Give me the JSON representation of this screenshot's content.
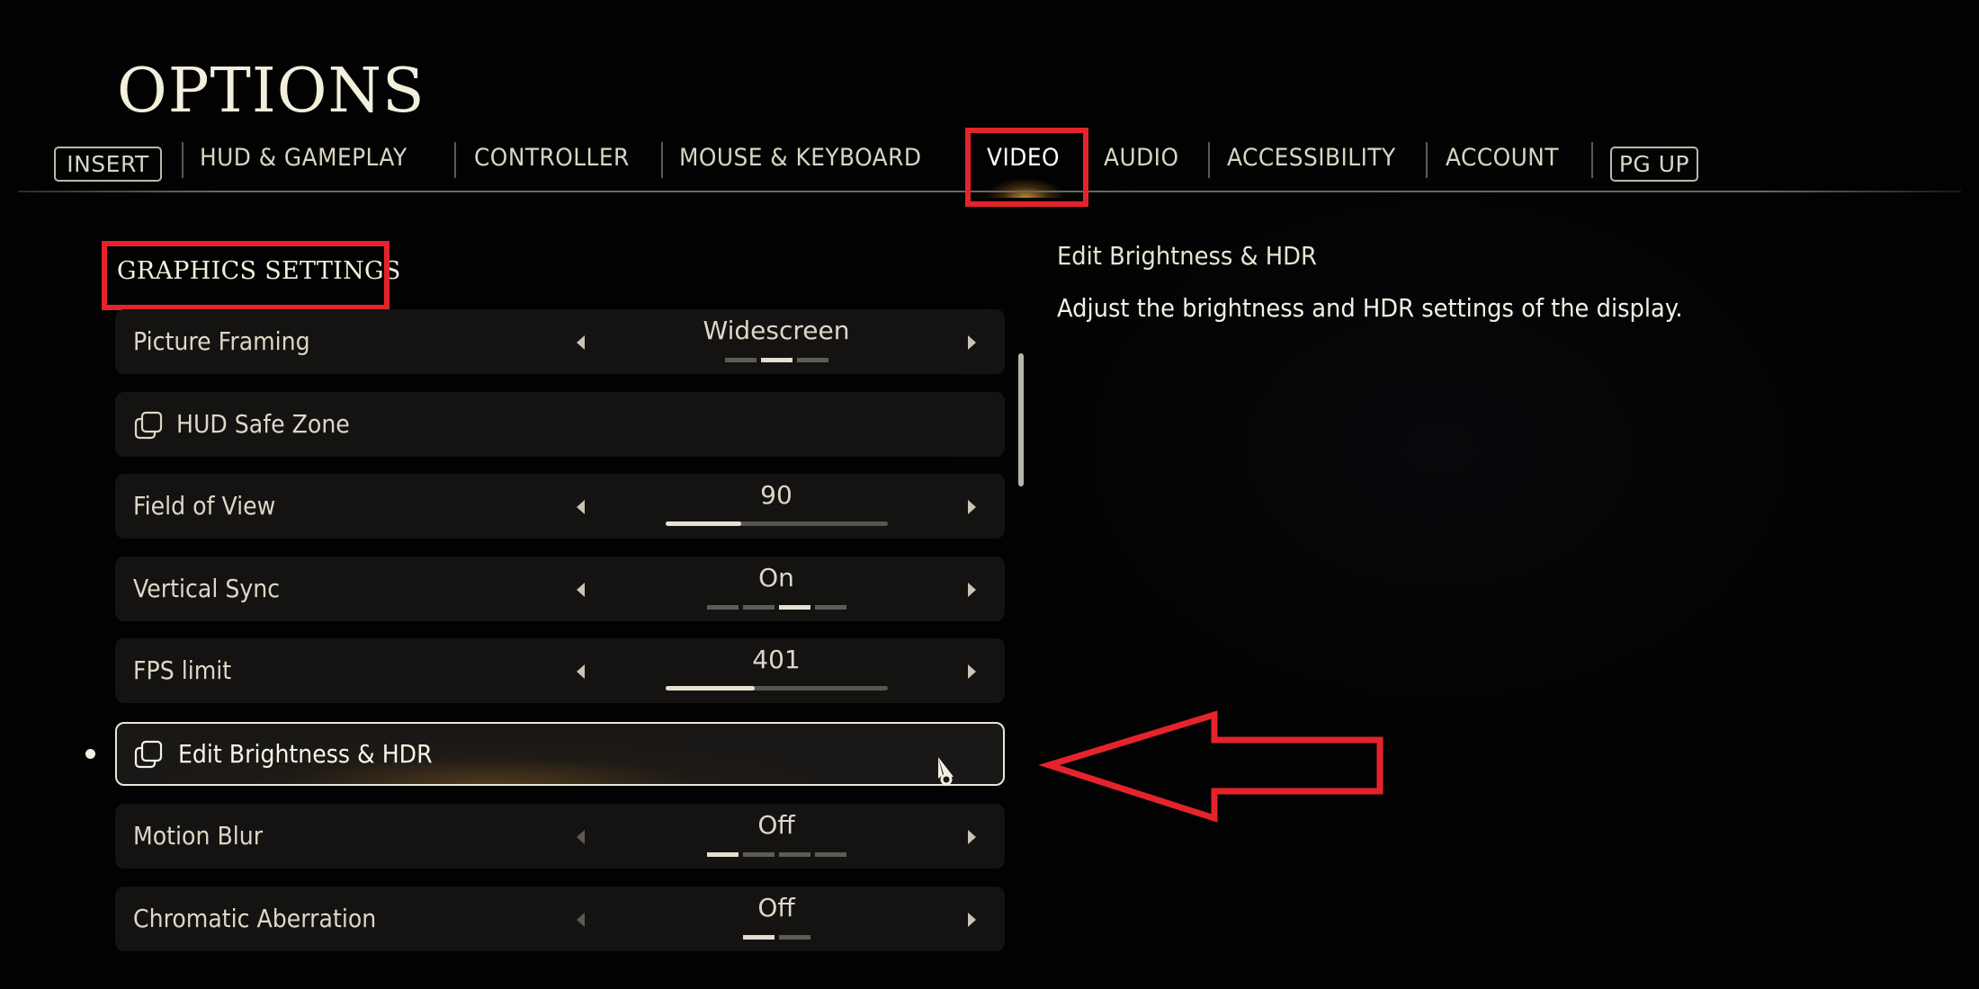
{
  "title": "OPTIONS",
  "tabs": {
    "prev_key": "INSERT",
    "next_key": "PG UP",
    "items": [
      {
        "label": "HUD & GAMEPLAY",
        "active": false
      },
      {
        "label": "CONTROLLER",
        "active": false
      },
      {
        "label": "MOUSE & KEYBOARD",
        "active": false
      },
      {
        "label": "VIDEO",
        "active": true
      },
      {
        "label": "AUDIO",
        "active": false
      },
      {
        "label": "ACCESSIBILITY",
        "active": false
      },
      {
        "label": "ACCOUNT",
        "active": false
      }
    ]
  },
  "section": {
    "title": "GRAPHICS SETTINGS"
  },
  "settings": [
    {
      "label": "Picture Framing",
      "type": "choice",
      "value": "Widescreen",
      "option_count": 3,
      "selected_index": 1,
      "left_disabled": false
    },
    {
      "label": "HUD Safe Zone",
      "type": "submenu",
      "icon": "external-window-icon"
    },
    {
      "label": "Field of View",
      "type": "slider",
      "value": "90",
      "fill_fraction": 0.34
    },
    {
      "label": "Vertical Sync",
      "type": "choice",
      "value": "On",
      "option_count": 4,
      "selected_index": 2,
      "left_disabled": false
    },
    {
      "label": "FPS limit",
      "type": "slider",
      "value": "401",
      "fill_fraction": 0.4
    },
    {
      "label": "Edit Brightness & HDR",
      "type": "submenu",
      "icon": "external-window-icon",
      "selected": true
    },
    {
      "label": "Motion Blur",
      "type": "choice",
      "value": "Off",
      "option_count": 4,
      "selected_index": 0,
      "left_disabled": true
    },
    {
      "label": "Chromatic Aberration",
      "type": "choice",
      "value": "Off",
      "option_count": 2,
      "selected_index": 0,
      "left_disabled": true
    }
  ],
  "scroll": {
    "thumb_fraction": 0.3
  },
  "description": {
    "title": "Edit Brightness & HDR",
    "body": "Adjust the brightness and HDR settings of the display."
  },
  "annotations": {
    "highlight_color": "#e5232b",
    "highlighted": [
      "VIDEO tab",
      "GRAPHICS SETTINGS heading"
    ],
    "arrow_points_to": "Edit Brightness & HDR"
  },
  "colors": {
    "text": "#e8e4d4",
    "row_bg": "#141312",
    "accent_glow": "#dca03c"
  }
}
